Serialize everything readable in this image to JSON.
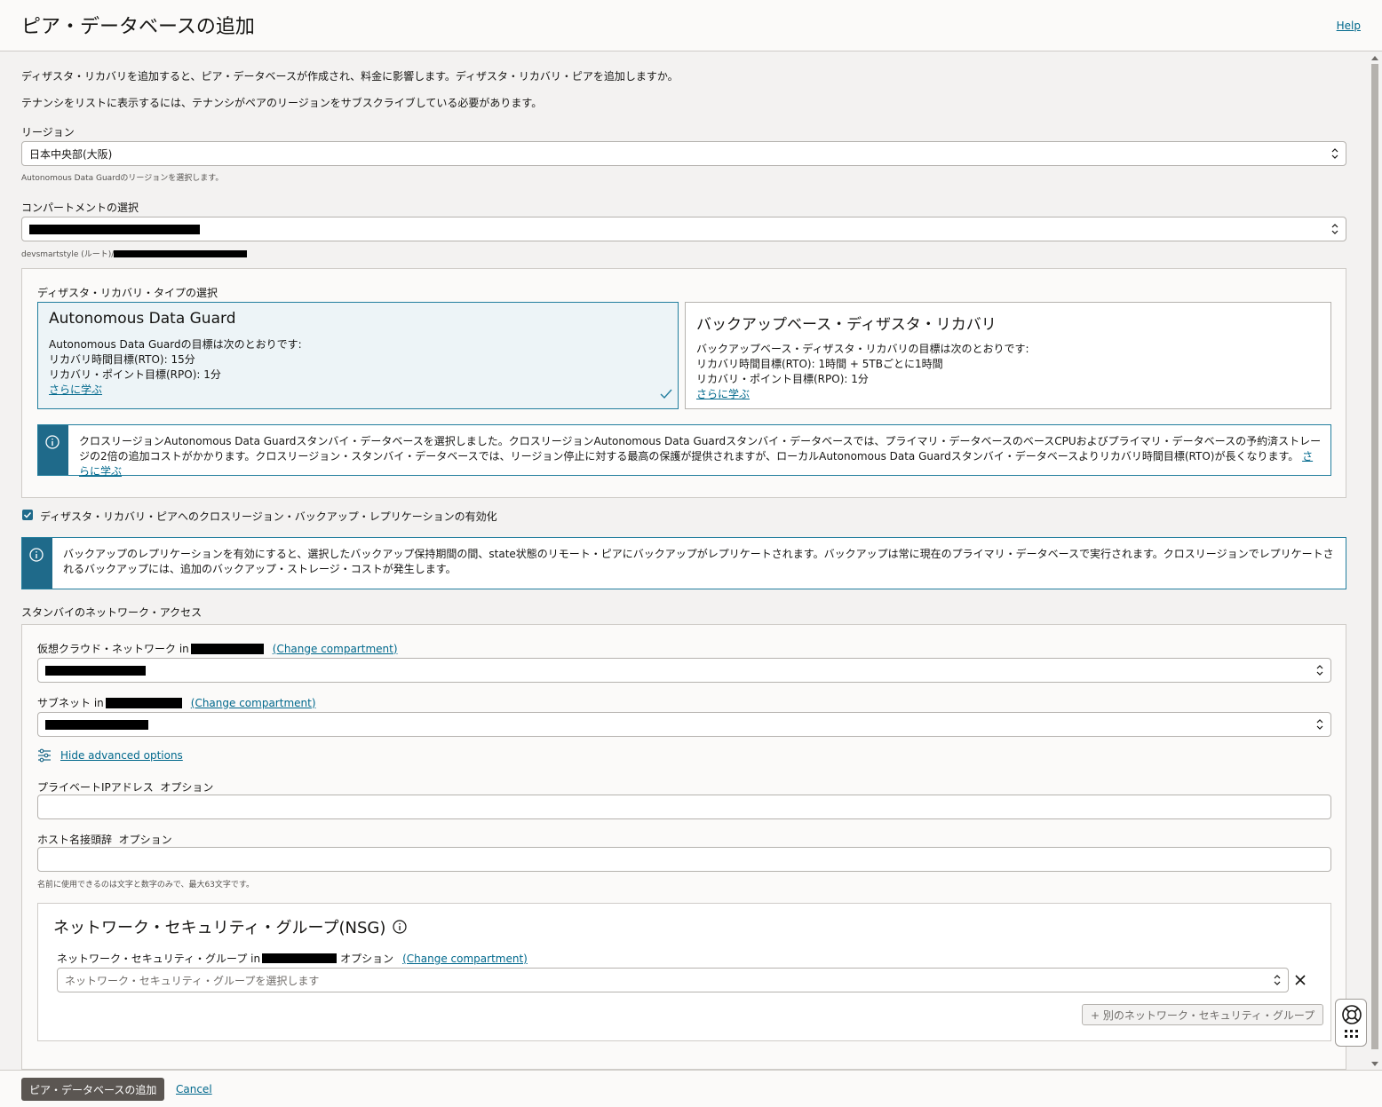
{
  "header": {
    "title": "ピア・データベースの追加",
    "help": "Help"
  },
  "intro": {
    "line1": "ディザスタ・リカバリを追加すると、ピア・データベースが作成され、料金に影響します。ディザスタ・リカバリ・ピアを追加しますか。",
    "line2": "テナンシをリストに表示するには、テナンシがペアのリージョンをサブスクライブしている必要があります。"
  },
  "region": {
    "label": "リージョン",
    "value": "日本中央部(大阪)",
    "hint": "Autonomous Data Guardのリージョンを選択します。"
  },
  "compartment": {
    "label": "コンパートメントの選択",
    "path_prefix": "devsmartstyle (ルート)/"
  },
  "dr_type": {
    "label": "ディザスタ・リカバリ・タイプの選択",
    "cards": [
      {
        "title": "Autonomous Data Guard",
        "line1": "Autonomous Data Guardの目標は次のとおりです:",
        "line2": "リカバリ時間目標(RTO): 15分",
        "line3": "リカバリ・ポイント目標(RPO): 1分",
        "link": "さらに学ぶ",
        "selected": true
      },
      {
        "title": "バックアップベース・ディザスタ・リカバリ",
        "line1": "バックアップベース・ディザスタ・リカバリの目標は次のとおりです:",
        "line2": "リカバリ時間目標(RTO): 1時間 + 5TBごとに1時間",
        "line3": "リカバリ・ポイント目標(RPO): 1分",
        "link": "さらに学ぶ",
        "selected": false
      }
    ],
    "info_text": "クロスリージョンAutonomous Data Guardスタンバイ・データベースを選択しました。クロスリージョンAutonomous Data Guardスタンバイ・データベースでは、プライマリ・データベースのベースCPUおよびプライマリ・データベースの予約済ストレージの2倍の追加コストがかかります。クロスリージョン・スタンバイ・データベースでは、リージョン停止に対する最高の保護が提供されますが、ローカルAutonomous Data Guardスタンバイ・データベースよりリカバリ時間目標(RTO)が長くなります。",
    "info_link": "さらに学ぶ"
  },
  "backup_replication": {
    "checkbox_label": "ディザスタ・リカバリ・ピアへのクロスリージョン・バックアップ・レプリケーションの有効化",
    "checked": true,
    "info_text": "バックアップのレプリケーションを有効にすると、選択したバックアップ保持期間の間、state状態のリモート・ピアにバックアップがレプリケートされます。バックアップは常に現在のプライマリ・データベースで実行されます。クロスリージョンでレプリケートされるバックアップには、追加のバックアップ・ストレージ・コストが発生します。"
  },
  "network": {
    "section_label": "スタンバイのネットワーク・アクセス",
    "vcn_label": "仮想クラウド・ネットワーク in",
    "subnet_label": "サブネット in",
    "change_compartment": "(Change compartment)",
    "advanced_toggle": "Hide advanced options",
    "private_ip_label": "プライベートIPアドレス",
    "optional": "オプション",
    "hostname_label": "ホスト名接頭辞",
    "hostname_hint": "名前に使用できるのは文字と数字のみで、最大63文字です。"
  },
  "nsg": {
    "title": "ネットワーク・セキュリティ・グループ(NSG)",
    "field_label": "ネットワーク・セキュリティ・グループ in",
    "optional": "オプション",
    "change_compartment": "(Change compartment)",
    "placeholder": "ネットワーク・セキュリティ・グループを選択します",
    "add_button": "+ 別のネットワーク・セキュリティ・グループ"
  },
  "footer": {
    "submit": "ピア・データベースの追加",
    "cancel": "Cancel"
  },
  "colors": {
    "accent": "#1f6a8a",
    "link": "#00688c",
    "primary_button": "#5b5652"
  }
}
